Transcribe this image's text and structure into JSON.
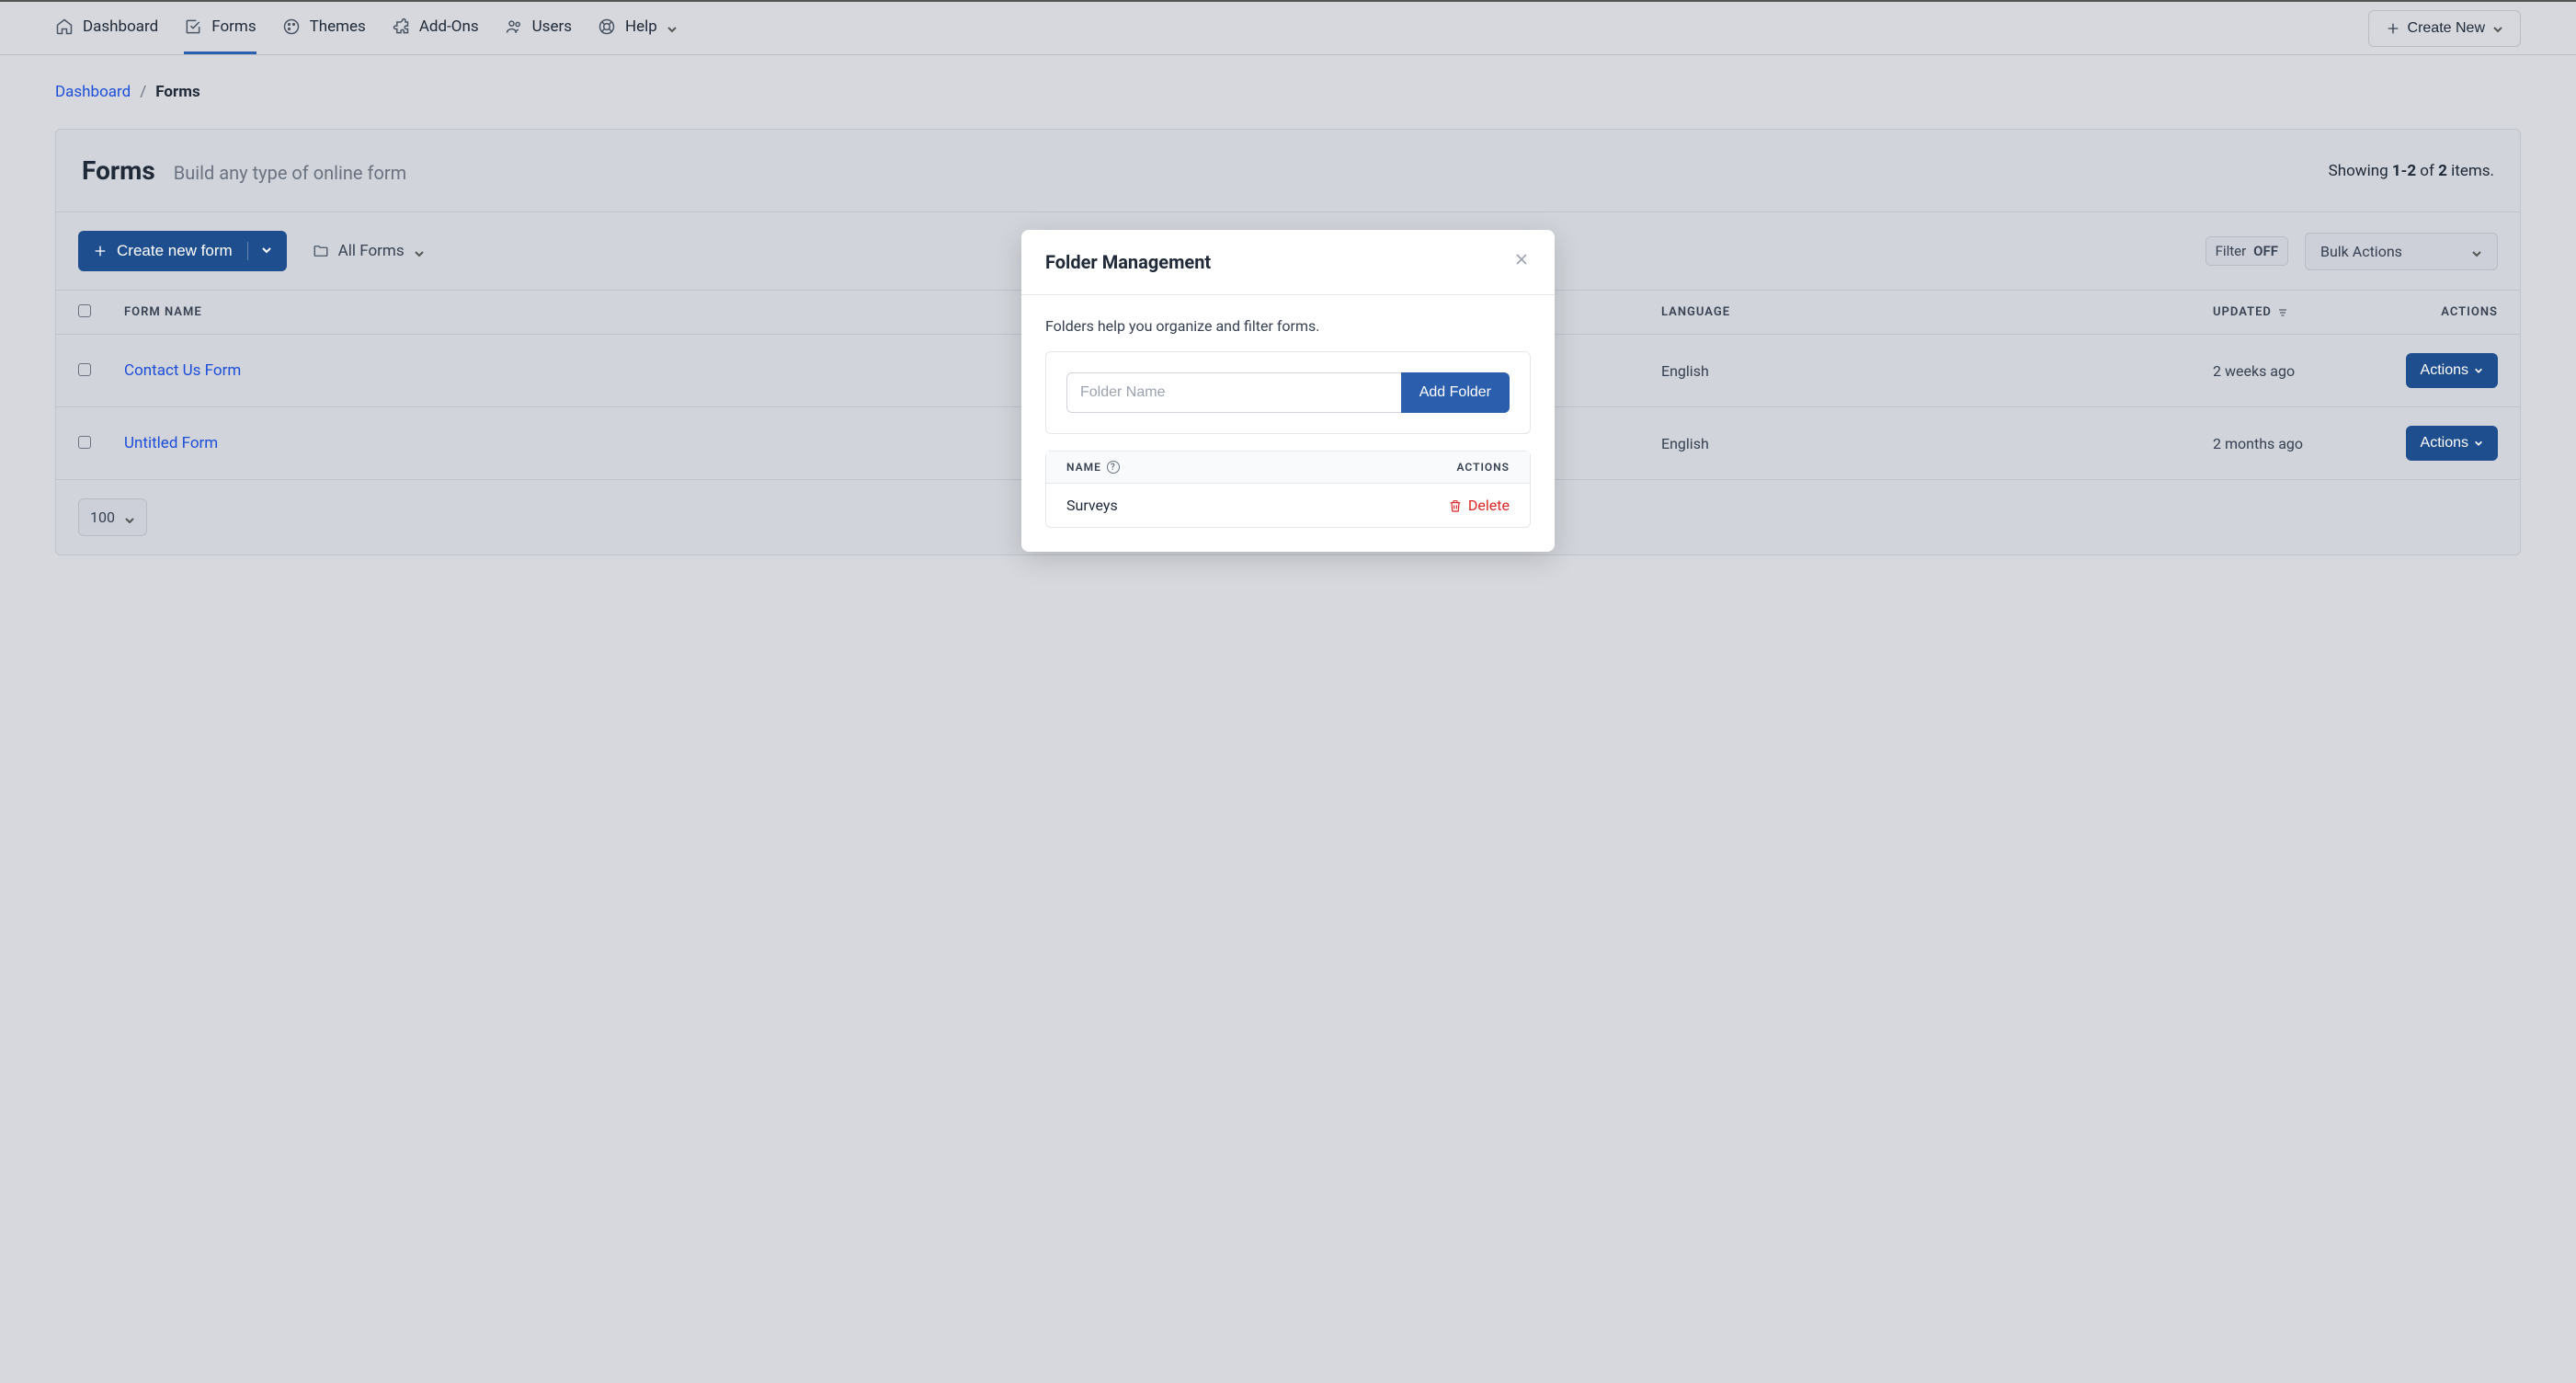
{
  "nav": {
    "items": [
      {
        "label": "Dashboard"
      },
      {
        "label": "Forms"
      },
      {
        "label": "Themes"
      },
      {
        "label": "Add-Ons"
      },
      {
        "label": "Users"
      },
      {
        "label": "Help"
      }
    ],
    "create_new": "Create New"
  },
  "breadcrumb": {
    "parent": "Dashboard",
    "sep": "/",
    "current": "Forms"
  },
  "panel": {
    "title": "Forms",
    "subtitle": "Build any type of online form",
    "count_prefix": "Showing ",
    "count_range": "1-2",
    "count_of": " of ",
    "count_total": "2",
    "count_suffix": " items."
  },
  "toolbar": {
    "create_form": "Create new form",
    "all_forms": "All Forms",
    "filter_label": "Filter",
    "filter_state": "OFF",
    "bulk_actions": "Bulk Actions"
  },
  "table": {
    "headers": {
      "form_name": "Form Name",
      "language": "Language",
      "updated": "Updated",
      "actions": "Actions"
    },
    "rows": [
      {
        "name": "Contact Us Form",
        "language": "English",
        "updated": "2 weeks ago",
        "action": "Actions"
      },
      {
        "name": "Untitled Form",
        "language": "English",
        "updated": "2 months ago",
        "action": "Actions"
      }
    ],
    "page_size": "100"
  },
  "modal": {
    "title": "Folder Management",
    "desc": "Folders help you organize and filter forms.",
    "placeholder": "Folder Name",
    "add_btn": "Add Folder",
    "th_name": "Name",
    "th_actions": "Actions",
    "folders": [
      {
        "name": "Surveys",
        "delete": "Delete"
      }
    ]
  }
}
